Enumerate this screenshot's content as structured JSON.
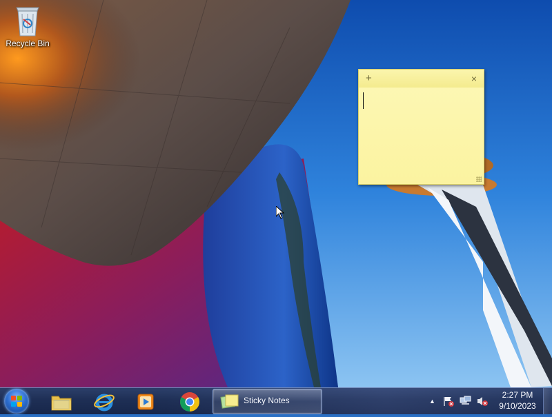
{
  "desktop": {
    "icons": [
      {
        "label": "Recycle Bin",
        "icon": "recycle-bin-icon"
      }
    ]
  },
  "sticky_note": {
    "title_add": "+",
    "title_close": "×",
    "text": "",
    "color": "#fdf8b6"
  },
  "taskbar": {
    "start_icon": "windows-start-orb",
    "pinned": [
      {
        "name": "Windows Explorer",
        "icon": "folder-icon"
      },
      {
        "name": "Internet Explorer",
        "icon": "internet-explorer-icon"
      },
      {
        "name": "Windows Media Player",
        "icon": "media-player-icon"
      },
      {
        "name": "Google Chrome",
        "icon": "chrome-icon"
      }
    ],
    "active_task": {
      "label": "Sticky Notes",
      "icon": "sticky-notes-icon"
    },
    "tray": {
      "show_hidden": "▲",
      "icons": [
        "action-center-flag-icon",
        "network-icon",
        "volume-muted-icon"
      ]
    },
    "clock": {
      "time": "2:27 PM",
      "date": "9/10/2023"
    }
  }
}
